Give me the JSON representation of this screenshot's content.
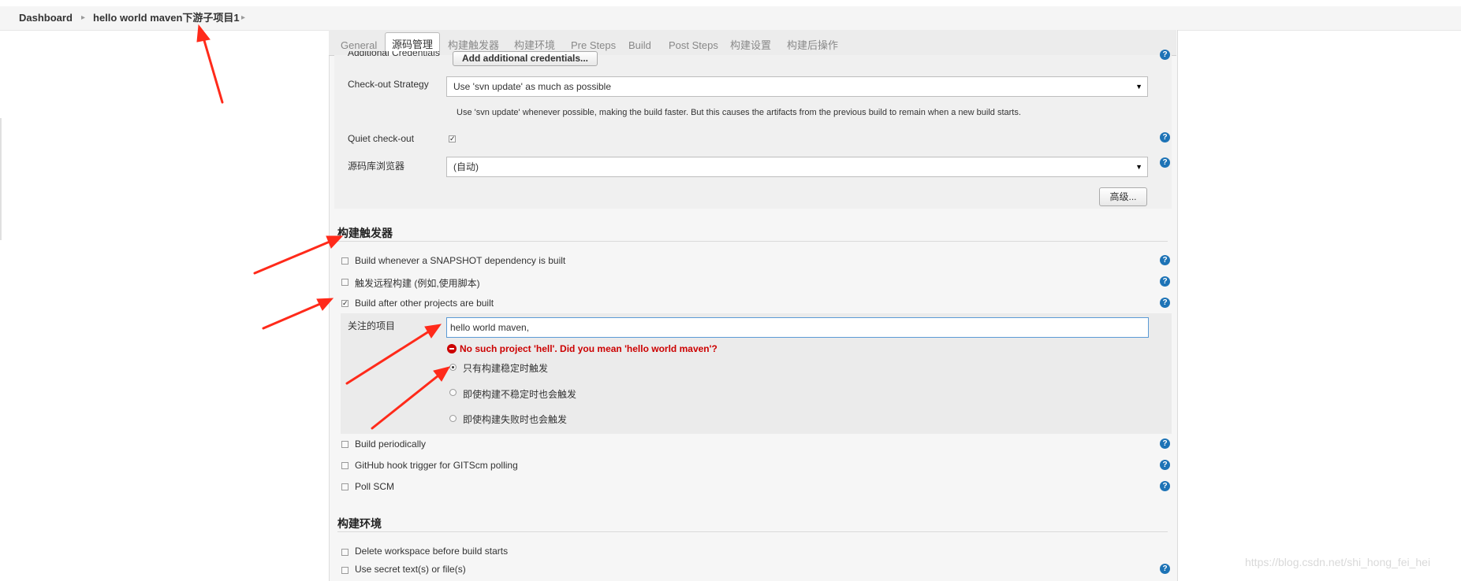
{
  "breadcrumb": {
    "home": "Dashboard",
    "project": "hello world maven下游子项目1"
  },
  "tabs": [
    {
      "label": "General"
    },
    {
      "label": "源码管理"
    },
    {
      "label": "构建触发器"
    },
    {
      "label": "构建环境"
    },
    {
      "label": "Pre Steps"
    },
    {
      "label": "Build"
    },
    {
      "label": "Post Steps"
    },
    {
      "label": "构建设置"
    },
    {
      "label": "构建后操作"
    }
  ],
  "scm": {
    "additional_credentials_label": "Additional Credentials",
    "add_credentials_button": "Add additional credentials...",
    "checkout_strategy_label": "Check-out Strategy",
    "checkout_strategy_value": "Use 'svn update' as much as possible",
    "checkout_strategy_desc": "Use 'svn update' whenever possible, making the build faster. But this causes the artifacts from the previous build to remain when a new build starts.",
    "quiet_checkout_label": "Quiet check-out",
    "repo_browser_label": "源码库浏览器",
    "repo_browser_value": "(自动)",
    "advanced_button": "高级..."
  },
  "triggers": {
    "title": "构建触发器",
    "snapshot": "Build whenever a SNAPSHOT dependency is built",
    "remote": "触发远程构建 (例如,使用脚本)",
    "after_other": "Build after other projects are built",
    "watched_label": "关注的项目",
    "watched_value": "hello world maven,",
    "error": "No such project 'hell'. Did you mean 'hello world maven'?",
    "radio_stable": "只有构建稳定时触发",
    "radio_unstable": "即使构建不稳定时也会触发",
    "radio_failed": "即使构建失败时也会触发",
    "periodically": "Build periodically",
    "github_hook": "GitHub hook trigger for GITScm polling",
    "poll_scm": "Poll SCM"
  },
  "env": {
    "title": "构建环境",
    "delete_workspace": "Delete workspace before build starts",
    "secret_text": "Use secret text(s) or file(s)"
  },
  "watermark": "https://blog.csdn.net/shi_hong_fei_hei",
  "icons": {
    "help": "help-icon",
    "error": "error-icon",
    "dropdown": "chevron-down-icon",
    "breadcrumb_sep": "chevron-right-icon"
  },
  "colors": {
    "help_blue": "#1d73b6",
    "error_red": "#cc0000",
    "annotation_arrow": "#ff2a1a"
  }
}
